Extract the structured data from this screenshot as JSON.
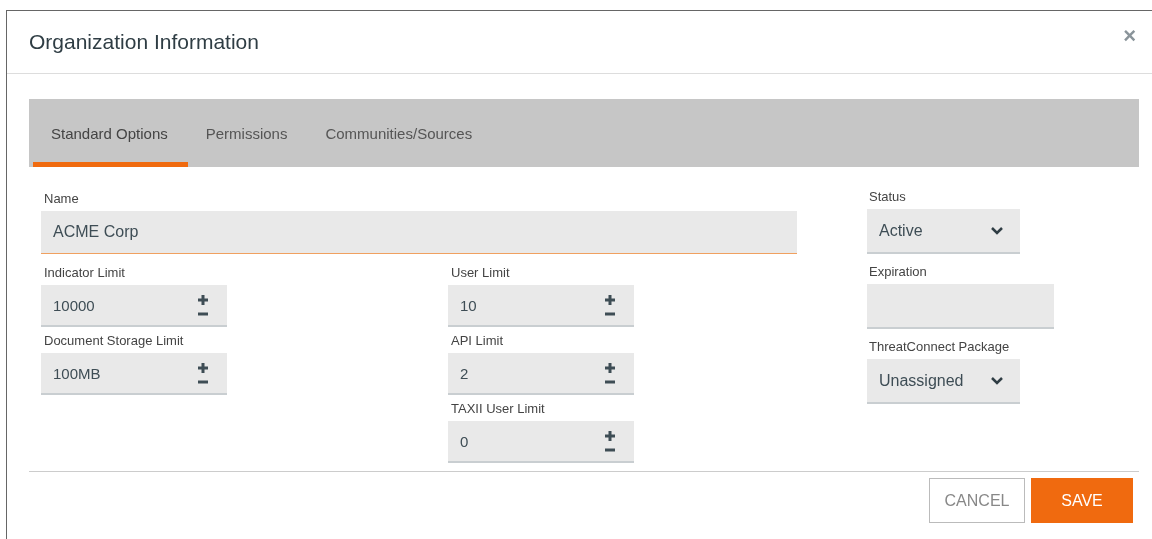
{
  "window": {
    "title": "Organization Information",
    "close": "×"
  },
  "tabs": [
    {
      "label": "Standard Options",
      "selected": true
    },
    {
      "label": "Permissions",
      "selected": false
    },
    {
      "label": "Communities/Sources",
      "selected": false
    }
  ],
  "name_field": {
    "label": "Name",
    "value": "ACME Corp"
  },
  "left_fields": [
    {
      "label": "Indicator Limit",
      "value": "10000"
    },
    {
      "label": "Document Storage Limit",
      "value": "100MB"
    }
  ],
  "middle_fields": [
    {
      "label": "User Limit",
      "value": "10"
    },
    {
      "label": "API Limit",
      "value": "2"
    },
    {
      "label": "TAXII User Limit",
      "value": "0"
    }
  ],
  "right_fields": [
    {
      "kind": "select",
      "label": "Status",
      "value": "Active"
    },
    {
      "kind": "text",
      "label": "Expiration"
    },
    {
      "kind": "select",
      "label": "ThreatConnect Package",
      "value": "Unassigned"
    }
  ],
  "buttons": [
    {
      "kind": "secondary",
      "label": "CANCEL"
    },
    {
      "kind": "primary",
      "label": "SAVE"
    }
  ]
}
